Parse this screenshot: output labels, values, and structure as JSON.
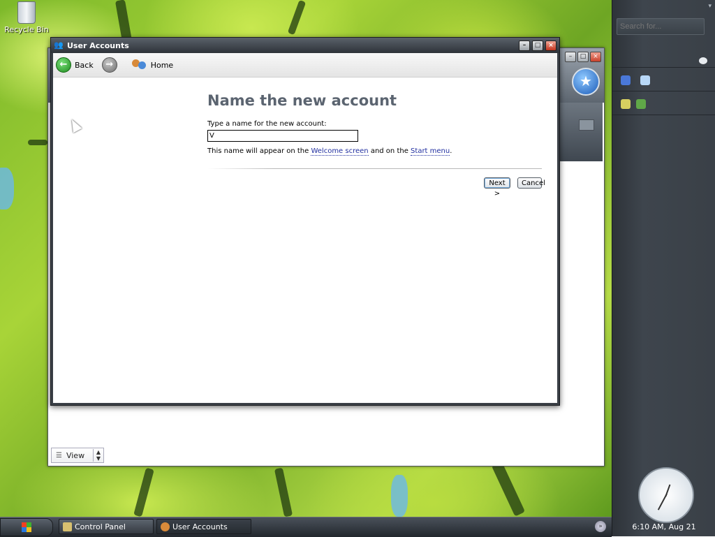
{
  "desktop": {
    "icons": [
      {
        "label": "Recycle Bin"
      }
    ]
  },
  "control_panel": {
    "view_label": "View"
  },
  "window": {
    "title": "User Accounts"
  },
  "toolbar": {
    "back_label": "Back",
    "home_label": "Home"
  },
  "wizard": {
    "heading": "Name the new account",
    "field_label": "Type a name for the new account:",
    "name_value": "V",
    "note_prefix": "This name will appear on the ",
    "welcome_link": "Welcome screen",
    "note_middle": " and on the ",
    "start_link": "Start menu",
    "note_suffix": ".",
    "next_label": "Next >",
    "cancel_label": "Cancel"
  },
  "sidebar": {
    "search_placeholder": "Search for...",
    "clock_text": "6:10 AM, Aug 21"
  },
  "taskbar": {
    "tasks": [
      {
        "label": "Control Panel"
      },
      {
        "label": "User Accounts"
      }
    ]
  },
  "colors": {
    "heading": "#5b6470",
    "link": "#2230a0",
    "close_button": "#c4341e",
    "wallpaper_green": "#7cb82a"
  }
}
